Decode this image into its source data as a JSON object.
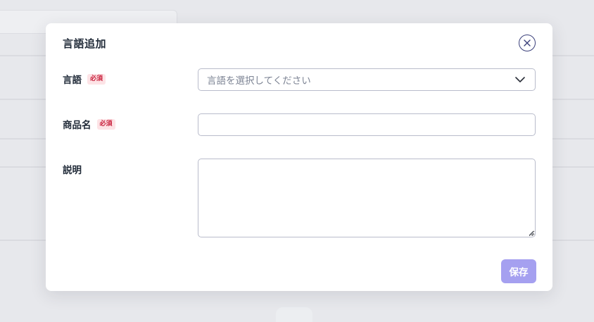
{
  "modal": {
    "title": "言語追加",
    "close_icon": "close-icon"
  },
  "fields": {
    "language": {
      "label": "言語",
      "required_badge": "必須",
      "placeholder": "言語を選択してください",
      "icon": "chevron-down-icon"
    },
    "product_name": {
      "label": "商品名",
      "required_badge": "必須",
      "value": ""
    },
    "description": {
      "label": "説明",
      "value": ""
    }
  },
  "actions": {
    "save_label": "保存"
  },
  "colors": {
    "accent": "#a5a0f0",
    "required_text": "#c81e3a",
    "required_bg": "#fde3e6",
    "close_icon": "#3a3f7a"
  }
}
